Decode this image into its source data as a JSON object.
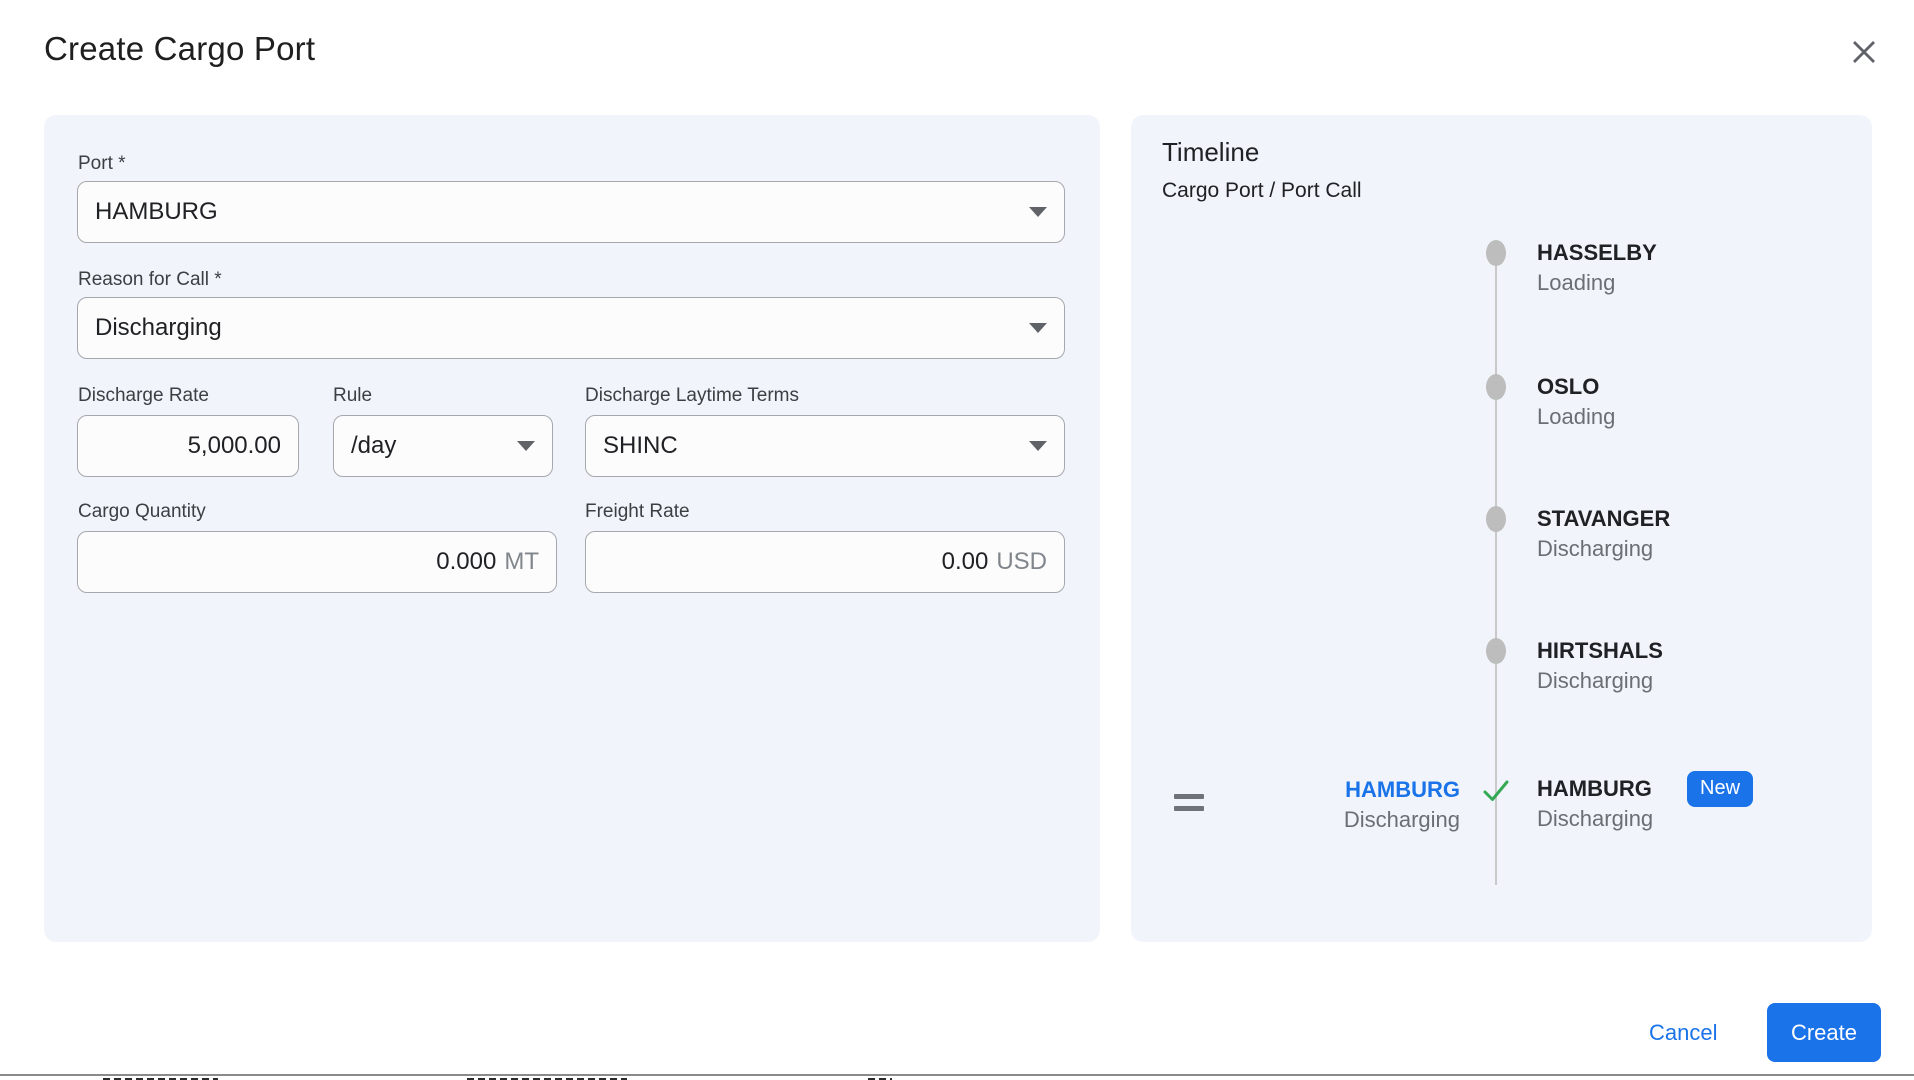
{
  "dialog": {
    "title": "Create Cargo Port"
  },
  "form": {
    "port": {
      "label": "Port *",
      "value": "HAMBURG"
    },
    "reason": {
      "label": "Reason for Call *",
      "value": "Discharging"
    },
    "discharge_rate": {
      "label": "Discharge Rate",
      "value": "5,000.00"
    },
    "rule": {
      "label": "Rule",
      "value": "/day"
    },
    "laytime": {
      "label": "Discharge Laytime Terms",
      "value": "SHINC"
    },
    "cargo_quantity": {
      "label": "Cargo Quantity",
      "value": "0.000",
      "unit": "MT"
    },
    "freight_rate": {
      "label": "Freight Rate",
      "value": "0.00",
      "unit": "USD"
    }
  },
  "timeline": {
    "title": "Timeline",
    "subtitle": "Cargo Port / Port Call",
    "items": [
      {
        "port": "HASSELBY",
        "reason": "Loading"
      },
      {
        "port": "OSLO",
        "reason": "Loading"
      },
      {
        "port": "STAVANGER",
        "reason": "Discharging"
      },
      {
        "port": "HIRTSHALS",
        "reason": "Discharging"
      }
    ],
    "new_item": {
      "left_port": "HAMBURG",
      "left_reason": "Discharging",
      "port": "HAMBURG",
      "reason": "Discharging",
      "badge": "New"
    }
  },
  "footer": {
    "cancel": "Cancel",
    "create": "Create"
  },
  "colors": {
    "accent": "#1a73e8",
    "success": "#34a853",
    "panel_bg": "#f1f5fb",
    "dot_gray": "#bdbdbd"
  }
}
